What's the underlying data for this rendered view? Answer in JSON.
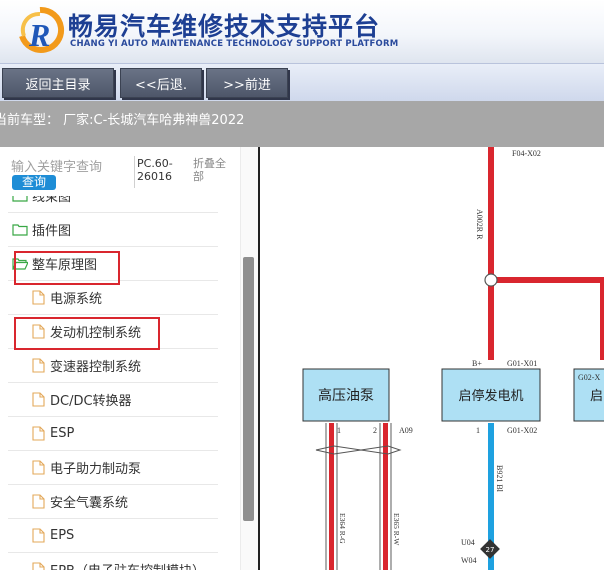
{
  "header": {
    "title_cn": "畅易汽车维修技术支持平台",
    "title_en": "CHANG YI AUTO MAINTENANCE TECHNOLOGY SUPPORT PLATFORM"
  },
  "toolbar": {
    "home_label": "返回主目录",
    "back_label": "<<后退.",
    "forward_label": ">>前进"
  },
  "vehicle": {
    "text": "当前车型： 厂家:C-长城汽车哈弗神兽2022"
  },
  "search": {
    "placeholder": "输入关键字查询",
    "button_label": "查询",
    "pc_code": "PC.60-26016",
    "collapse_label": "折叠全部"
  },
  "tree": {
    "items": [
      {
        "label": "线束图",
        "level": 0,
        "icon": "folder-icon"
      },
      {
        "label": "插件图",
        "level": 0,
        "icon": "folder-icon"
      },
      {
        "label": "整车原理图",
        "level": 0,
        "icon": "folder-open-icon"
      },
      {
        "label": "电源系统",
        "level": 1,
        "icon": "file-icon"
      },
      {
        "label": "发动机控制系统",
        "level": 1,
        "icon": "file-icon"
      },
      {
        "label": "变速器控制系统",
        "level": 1,
        "icon": "file-icon"
      },
      {
        "label": "DC/DC转换器",
        "level": 1,
        "icon": "file-icon"
      },
      {
        "label": "ESP",
        "level": 1,
        "icon": "file-icon"
      },
      {
        "label": "电子助力制动泵",
        "level": 1,
        "icon": "file-icon"
      },
      {
        "label": "安全气囊系统",
        "level": 1,
        "icon": "file-icon"
      },
      {
        "label": "EPS",
        "level": 1,
        "icon": "file-icon"
      },
      {
        "label": "EPB（电子驻车控制模块）",
        "level": 1,
        "icon": "file-icon"
      }
    ]
  },
  "diagram": {
    "conn_top": "F04-X02",
    "wire_main": "A002R R",
    "box1": "高压油泵",
    "box2": "启停发电机",
    "box3": "启",
    "pin_bplus": "B+",
    "conn_g01x01": "G01-X01",
    "conn_g02": "G02-X",
    "pin1": "1",
    "pin2": "2",
    "conn_a09": "A09",
    "pin_g01_1": "1",
    "conn_g01x02": "G01-X02",
    "wire_b921": "B921 Bl",
    "wire_e364": "E364 R-G",
    "wire_e365": "E365 R-W",
    "splice_u04": "U04",
    "splice_w04": "W04",
    "splice_num": "27",
    "colors": {
      "red": "#d9262e",
      "blue": "#1ea1e0",
      "box_fill": "#aee0f4"
    }
  }
}
